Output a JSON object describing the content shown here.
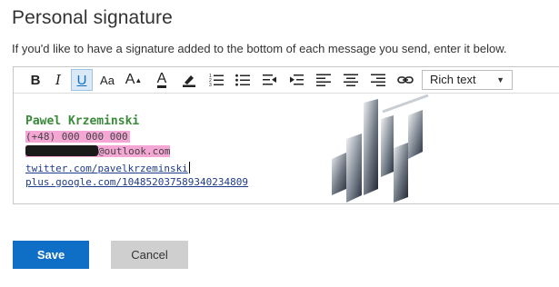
{
  "page": {
    "title": "Personal signature",
    "description": "If you'd like to have a signature added to the bottom of each message you send, enter it below."
  },
  "toolbar": {
    "bold": "B",
    "italic": "I",
    "underline": "U",
    "font_size": "Aa",
    "grow_font": "A",
    "font_color": "A",
    "format_select": {
      "value": "Rich text"
    }
  },
  "signature": {
    "name": "Pawel Krzeminski",
    "phone": "(+48) 000 000 000",
    "email_suffix": "@outlook.com",
    "twitter": "twitter.com/pavelkrzeminski",
    "plus": "plus.google.com/104852037589340234809"
  },
  "buttons": {
    "save": "Save",
    "cancel": "Cancel"
  },
  "colors": {
    "accent": "#0f6fc6",
    "name_green": "#3a8a3a",
    "highlight_pink": "#f4a7d5",
    "link_blue": "#1f3b8c"
  },
  "icons": [
    "bold",
    "italic",
    "underline",
    "font-size-icon",
    "grow-font-icon",
    "font-color-icon",
    "highlight-icon",
    "numbered-list-icon",
    "bullet-list-icon",
    "decrease-indent-icon",
    "increase-indent-icon",
    "align-left-icon",
    "align-center-icon",
    "align-right-icon",
    "link-icon"
  ]
}
